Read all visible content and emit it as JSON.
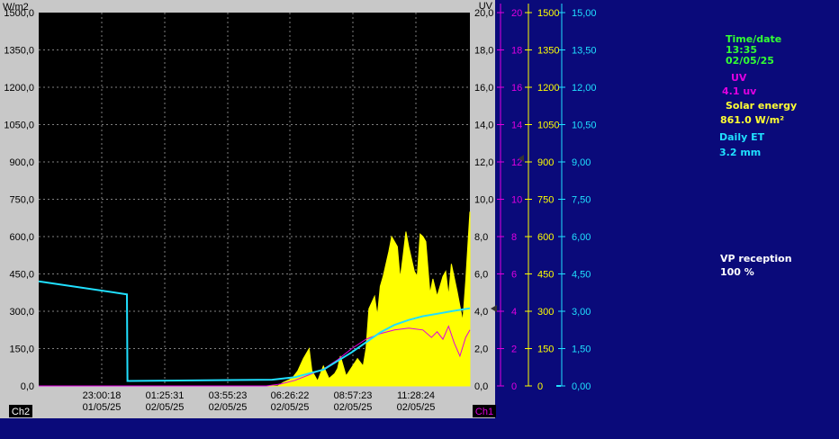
{
  "colors": {
    "background": "#0a0a7a",
    "frame": "#c8c8c8",
    "plot_bg": "#000000",
    "grid": "#808080",
    "solar": "#ffff00",
    "uv": "#e000e0",
    "et": "#20e0ff",
    "time_label": "#33ff33"
  },
  "left_axis": {
    "unit": "W/m2",
    "ticks": [
      "0,0",
      "150,0",
      "300,0",
      "450,0",
      "600,0",
      "750,0",
      "900,0",
      "1050,0",
      "1200,0",
      "1350,0",
      "1500,0"
    ]
  },
  "right_axis_1": {
    "unit": "UV",
    "ticks": [
      "0,0",
      "2,0",
      "4,0",
      "6,0",
      "8,0",
      "10,0",
      "12,0",
      "14,0",
      "16,0",
      "18,0",
      "20,0"
    ]
  },
  "uv_axis": {
    "ticks": [
      "0",
      "2",
      "4",
      "6",
      "8",
      "10",
      "12",
      "14",
      "16",
      "18",
      "20"
    ]
  },
  "solar_axis": {
    "ticks": [
      "0",
      "150",
      "300",
      "450",
      "600",
      "750",
      "900",
      "1050",
      "1200",
      "1350",
      "1500"
    ]
  },
  "et_axis": {
    "ticks": [
      "0,00",
      "1,50",
      "3,00",
      "4,50",
      "6,00",
      "7,50",
      "9,00",
      "10,50",
      "12,00",
      "13,50",
      "15,00"
    ]
  },
  "x_labels": [
    {
      "time": "23:00:18",
      "date": "01/05/25"
    },
    {
      "time": "01:25:31",
      "date": "02/05/25"
    },
    {
      "time": "03:55:23",
      "date": "02/05/25"
    },
    {
      "time": "06:26:22",
      "date": "02/05/25"
    },
    {
      "time": "08:57:23",
      "date": "02/05/25"
    },
    {
      "time": "11:28:24",
      "date": "02/05/25"
    }
  ],
  "channel_left": "Ch2",
  "channel_right": "Ch1",
  "info": {
    "time_label": "Time/date",
    "time_value": "13:35",
    "date_value": "02/05/25",
    "uv_label": "UV",
    "uv_value": "4.1 uv",
    "solar_label": "Solar energy",
    "solar_value": "861.0 W/m²",
    "et_label": "Daily ET",
    "et_value": "3.2 mm",
    "vp_label": "VP reception",
    "vp_value": "100 %"
  },
  "chart_data": {
    "type": "area",
    "x_range": [
      "01/05/25 21:39",
      "02/05/25 13:35"
    ],
    "series": [
      {
        "name": "Solar energy",
        "unit": "W/m2",
        "x_hours": [
          0,
          8.4,
          8.6,
          8.9,
          9.1,
          9.3,
          9.5,
          9.6,
          9.7,
          9.8,
          10.0,
          10.2,
          10.4,
          10.5,
          10.6,
          10.8,
          11.0,
          11.2,
          11.4,
          11.5,
          11.6,
          11.8,
          11.9,
          12.0,
          12.1,
          12.3,
          12.4,
          12.6,
          12.7,
          12.8,
          12.9,
          13.0,
          13.2,
          13.3,
          13.4,
          13.5,
          13.6,
          13.75,
          13.85,
          14.0,
          14.2,
          14.3,
          14.4,
          14.5,
          14.7,
          14.9,
          15.0,
          15.15
        ],
        "values": [
          0,
          0,
          15,
          30,
          60,
          110,
          150,
          60,
          40,
          20,
          80,
          30,
          50,
          70,
          120,
          40,
          75,
          110,
          80,
          150,
          310,
          360,
          280,
          400,
          440,
          540,
          600,
          560,
          430,
          520,
          620,
          560,
          460,
          440,
          610,
          600,
          580,
          370,
          430,
          360,
          440,
          460,
          360,
          490,
          380,
          260,
          420,
          700
        ]
      },
      {
        "name": "UV",
        "unit": "UV",
        "x_hours": [
          0,
          8.0,
          8.5,
          9.0,
          9.5,
          10.0,
          10.5,
          11.0,
          11.5,
          12.0,
          12.5,
          13.0,
          13.5,
          13.8,
          14.0,
          14.2,
          14.4,
          14.6,
          14.8,
          15.0,
          15.15
        ],
        "values": [
          0,
          0,
          0.1,
          0.3,
          0.6,
          0.9,
          1.4,
          2.0,
          2.5,
          2.8,
          3.0,
          3.1,
          3.0,
          2.6,
          2.9,
          2.5,
          3.2,
          2.3,
          1.6,
          2.6,
          3.0
        ]
      },
      {
        "name": "Daily ET",
        "unit": "mm",
        "x_hours": [
          0,
          3.1,
          3.12,
          8.2,
          9.0,
          10.0,
          11.0,
          12.0,
          12.5,
          13.0,
          13.5,
          14.0,
          14.5,
          15.15
        ],
        "values": [
          4.2,
          3.68,
          0.2,
          0.25,
          0.35,
          0.65,
          1.35,
          2.15,
          2.45,
          2.65,
          2.8,
          2.9,
          3.0,
          3.12
        ]
      }
    ]
  }
}
